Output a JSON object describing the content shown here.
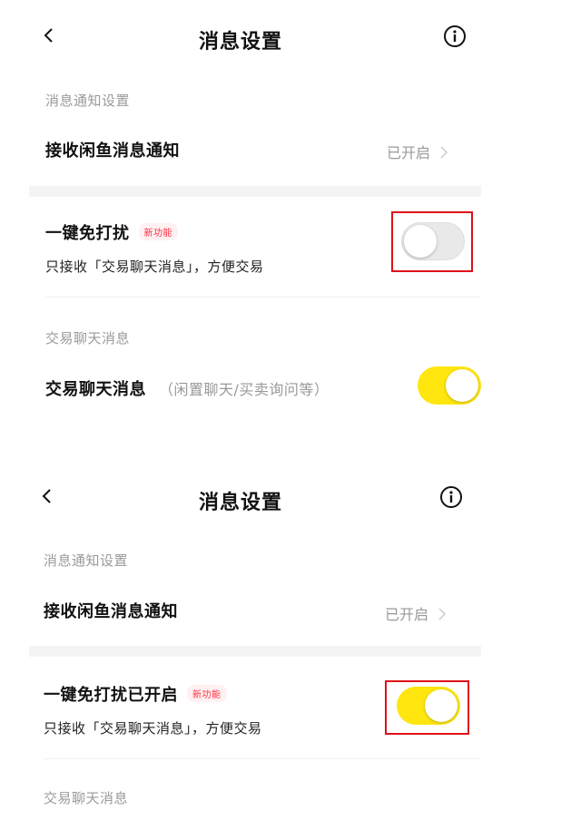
{
  "screens": [
    {
      "header": {
        "title": "消息设置",
        "back_icon": "chevron-left-icon",
        "info_icon": "info-circle-icon"
      },
      "notification_section": {
        "label": "消息通知设置",
        "row_title": "接收闲鱼消息通知",
        "status": "已开启"
      },
      "dnd_row": {
        "title": "一键免打扰",
        "badge": "新功能",
        "description": "只接收「交易聊天消息」，方便交易",
        "toggle_on": false
      },
      "trade_section": {
        "label": "交易聊天消息",
        "row_title": "交易聊天消息",
        "row_subtitle": "（闲置聊天/买卖询问等）",
        "toggle_on": true
      }
    },
    {
      "header": {
        "title": "消息设置",
        "back_icon": "chevron-left-icon",
        "info_icon": "info-circle-icon"
      },
      "notification_section": {
        "label": "消息通知设置",
        "row_title": "接收闲鱼消息通知",
        "status": "已开启"
      },
      "dnd_row": {
        "title": "一键免打扰已开启",
        "badge": "新功能",
        "description": "只接收「交易聊天消息」，方便交易",
        "toggle_on": true
      },
      "trade_section": {
        "label": "交易聊天消息"
      }
    }
  ],
  "colors": {
    "toggle_on": "#ffe60f",
    "toggle_off": "#e9e9e9",
    "highlight_border": "#e0101a",
    "badge_text": "#ff2f3f",
    "muted_text": "#999999"
  }
}
